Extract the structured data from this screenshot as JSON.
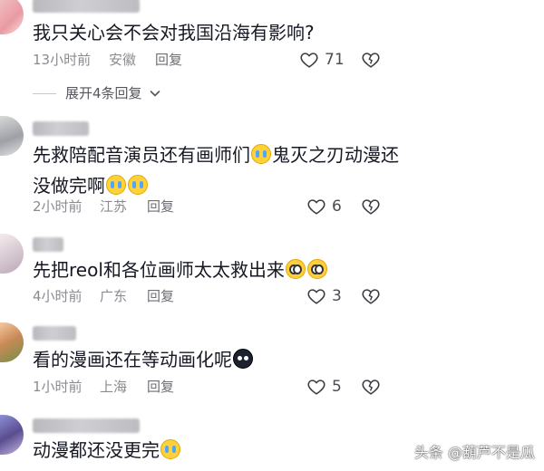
{
  "comments": [
    {
      "username": "太原新专痛大睡子",
      "text": "我只关心会不会对我国沿海有影响?",
      "text_suffix": "",
      "time": "13小时前",
      "location": "安徽",
      "reply_label": "回复",
      "likes": "71"
    },
    {
      "username": "智商欠款",
      "text": "先救陪配音演员还有画师们",
      "text_suffix": "鬼灭之刃动漫还没做完啊",
      "time": "2小时前",
      "location": "江苏",
      "reply_label": "回复",
      "likes": "6"
    },
    {
      "username": "陶陶",
      "text": "先把reol和各位画师太太救出来",
      "text_suffix": "",
      "time": "4小时前",
      "location": "广东",
      "reply_label": "回复",
      "likes": "3"
    },
    {
      "username": "久恋漫",
      "text": "看的漫画还在等动画化呢",
      "text_suffix": "",
      "time": "1小时前",
      "location": "上海",
      "reply_label": "回复",
      "likes": "5"
    },
    {
      "username": "七早早0J（四零）",
      "text": "动漫都还没更完",
      "text_suffix": "",
      "time": "",
      "location": "",
      "reply_label": "",
      "likes": ""
    }
  ],
  "expand_replies_label": "展开4条回复",
  "watermark": "头条 @葫芦不是瓜",
  "icons": {
    "like": "heart-outline-icon",
    "dislike": "broken-heart-icon",
    "expand": "chevron-down-icon"
  },
  "colors": {
    "text": "#161823",
    "meta": "#8a8b91",
    "background": "#ffffff"
  }
}
